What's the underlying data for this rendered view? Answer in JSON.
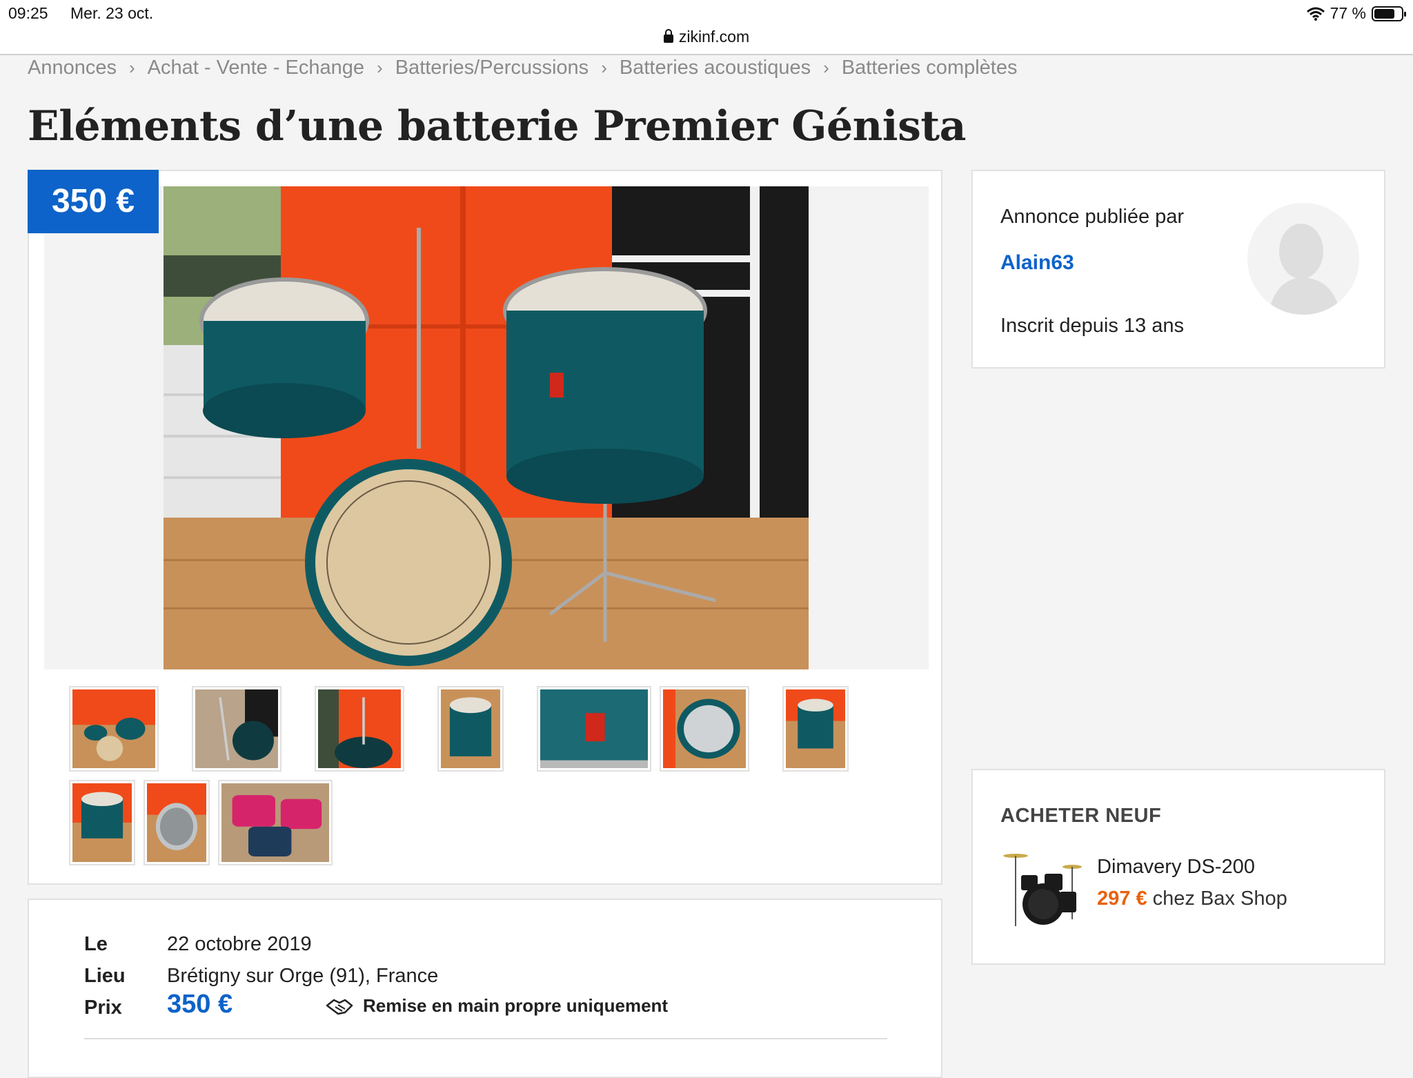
{
  "status_bar": {
    "time": "09:25",
    "date": "Mer. 23 oct.",
    "battery": "77 %",
    "battery_level": 0.77
  },
  "browser": {
    "url": "zikinf.com"
  },
  "breadcrumb": {
    "items": [
      {
        "label": "Annonces"
      },
      {
        "label": "Achat - Vente - Echange"
      },
      {
        "label": "Batteries/Percussions"
      },
      {
        "label": "Batteries acoustiques"
      },
      {
        "label": "Batteries complètes"
      }
    ]
  },
  "listing": {
    "title": "Eléments d’une batterie Premier Génista",
    "price_badge": "350 €",
    "thumbnail_count": 10
  },
  "details": {
    "date_label": "Le",
    "date_value": "22 octobre 2019",
    "place_label": "Lieu",
    "place_value": "Brétigny sur Orge (91), France",
    "price_label": "Prix",
    "price_value": "350 €",
    "handover": "Remise en main propre uniquement"
  },
  "seller": {
    "published_by": "Annonce publiée par",
    "name": "Alain63",
    "member_since": "Inscrit depuis 13 ans"
  },
  "buy_new": {
    "title": "ACHETER NEUF",
    "product_name": "Dimavery DS-200",
    "product_price": "297 €",
    "product_shop": "chez Bax Shop"
  },
  "colors": {
    "accent_blue": "#0d63c9",
    "price_orange": "#e8620e",
    "page_background": "#f4f4f4"
  }
}
